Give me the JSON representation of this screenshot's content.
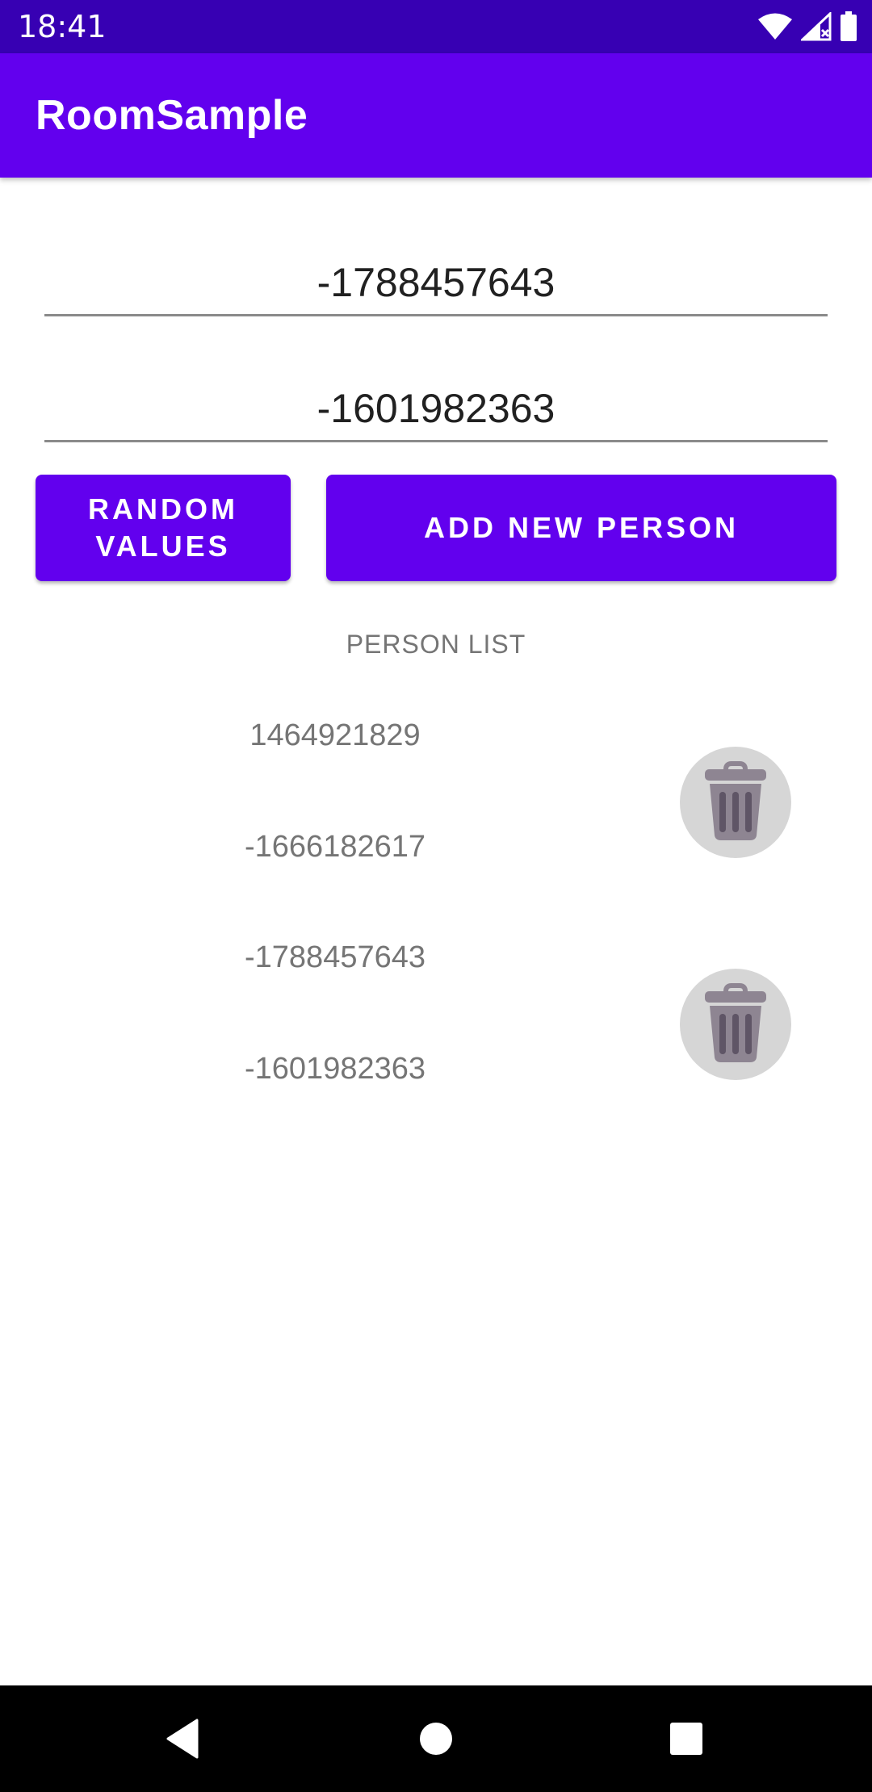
{
  "status_bar": {
    "time": "18:41",
    "icons": [
      "wifi-icon",
      "signal-icon",
      "battery-icon"
    ]
  },
  "app_bar": {
    "title": "RoomSample"
  },
  "form": {
    "field_1_value": "-1788457643",
    "field_2_value": "-1601982363"
  },
  "buttons": {
    "random_label": "RANDOM\nVALUES",
    "add_label": "ADD NEW PERSON"
  },
  "person_list": {
    "label": "PERSON LIST",
    "items": [
      {
        "first": "1464921829",
        "second": "-1666182617",
        "delete_icon": "trash-icon"
      },
      {
        "first": "-1788457643",
        "second": "-1601982363",
        "delete_icon": "trash-icon"
      }
    ]
  },
  "nav_bar": {
    "icons": [
      "back-icon",
      "home-icon",
      "recents-icon"
    ]
  },
  "colors": {
    "primary": "#6200ee",
    "primary_dark": "#3700b3",
    "delete_background": "#d6d6d6",
    "trash_icon": "#8e8592"
  }
}
